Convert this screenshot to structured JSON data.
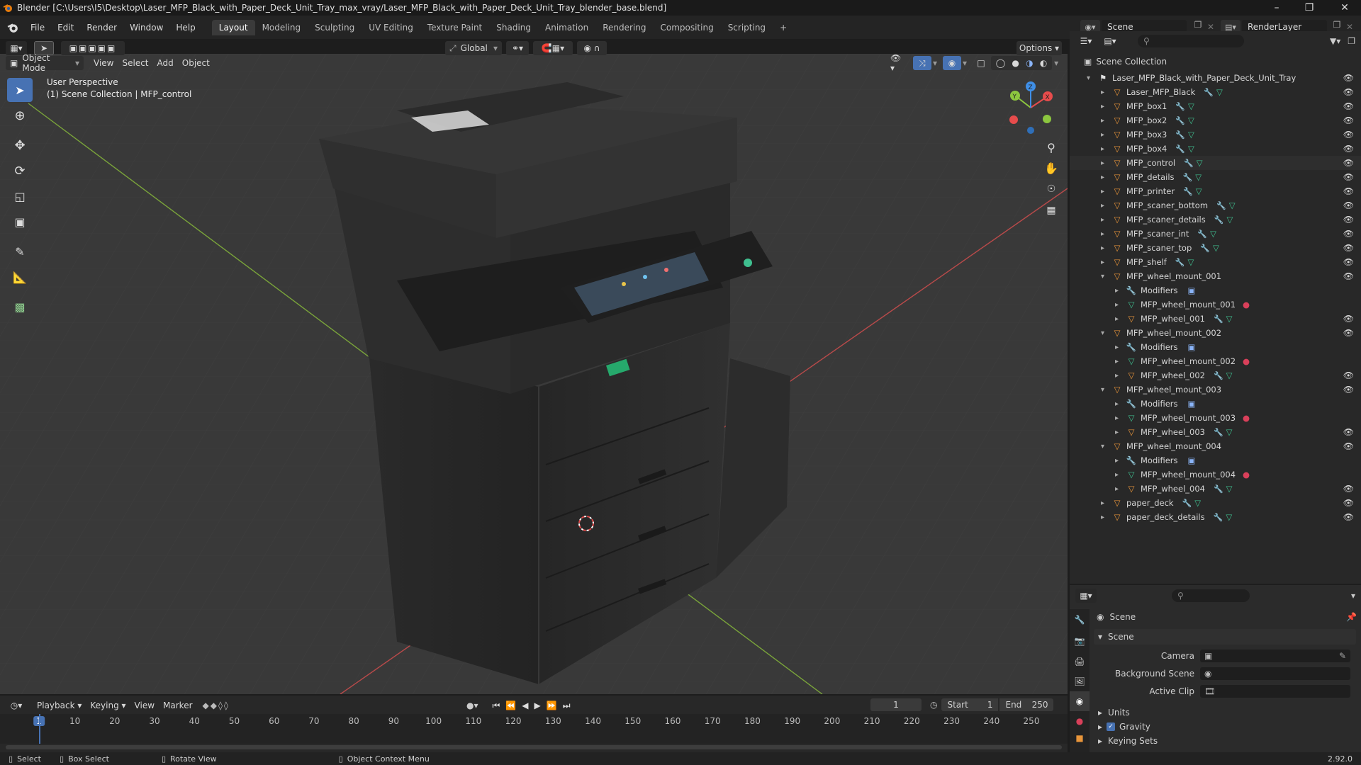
{
  "title_bar": {
    "title": "Blender [C:\\Users\\I5\\Desktop\\Laser_MFP_Black_with_Paper_Deck_Unit_Tray_max_vray/Laser_MFP_Black_with_Paper_Deck_Unit_Tray_blender_base.blend]"
  },
  "menu": [
    "File",
    "Edit",
    "Render",
    "Window",
    "Help"
  ],
  "workspaces": [
    "Layout",
    "Modeling",
    "Sculpting",
    "UV Editing",
    "Texture Paint",
    "Shading",
    "Animation",
    "Rendering",
    "Compositing",
    "Scripting"
  ],
  "workspace_active": "Layout",
  "scene_name": "Scene",
  "render_layer": "RenderLayer",
  "viewport_header": {
    "orientation": "Global",
    "options_label": "Options",
    "mode": "Object Mode",
    "menus": [
      "View",
      "Select",
      "Add",
      "Object"
    ]
  },
  "viewport": {
    "perspective": "User Perspective",
    "collection_info": "(1) Scene Collection | MFP_control",
    "gizmo_axes": [
      "X",
      "Y",
      "Z"
    ]
  },
  "outliner": {
    "root": "Scene Collection",
    "items": [
      {
        "name": "Laser_MFP_Black_with_Paper_Deck_Unit_Tray",
        "depth": 0,
        "type": "collection",
        "eye": true
      },
      {
        "name": "Laser_MFP_Black",
        "depth": 1,
        "type": "mesh",
        "eye": true
      },
      {
        "name": "MFP_box1",
        "depth": 1,
        "type": "mesh",
        "eye": true
      },
      {
        "name": "MFP_box2",
        "depth": 1,
        "type": "mesh",
        "eye": true
      },
      {
        "name": "MFP_box3",
        "depth": 1,
        "type": "mesh",
        "eye": true
      },
      {
        "name": "MFP_box4",
        "depth": 1,
        "type": "mesh",
        "eye": true
      },
      {
        "name": "MFP_control",
        "depth": 1,
        "type": "mesh",
        "eye": true
      },
      {
        "name": "MFP_details",
        "depth": 1,
        "type": "mesh",
        "eye": true
      },
      {
        "name": "MFP_printer",
        "depth": 1,
        "type": "mesh",
        "eye": true
      },
      {
        "name": "MFP_scaner_bottom",
        "depth": 1,
        "type": "mesh",
        "eye": true
      },
      {
        "name": "MFP_scaner_details",
        "depth": 1,
        "type": "mesh",
        "eye": true
      },
      {
        "name": "MFP_scaner_int",
        "depth": 1,
        "type": "mesh",
        "eye": true
      },
      {
        "name": "MFP_scaner_top",
        "depth": 1,
        "type": "mesh",
        "eye": true
      },
      {
        "name": "MFP_shelf",
        "depth": 1,
        "type": "mesh",
        "eye": true
      },
      {
        "name": "MFP_wheel_mount_001",
        "depth": 1,
        "type": "mesh-open",
        "eye": true
      },
      {
        "name": "Modifiers",
        "depth": 2,
        "type": "modifiers",
        "eye": false
      },
      {
        "name": "MFP_wheel_mount_001",
        "depth": 2,
        "type": "meshdata",
        "eye": false
      },
      {
        "name": "MFP_wheel_001",
        "depth": 2,
        "type": "mesh",
        "eye": true
      },
      {
        "name": "MFP_wheel_mount_002",
        "depth": 1,
        "type": "mesh-open",
        "eye": true
      },
      {
        "name": "Modifiers",
        "depth": 2,
        "type": "modifiers",
        "eye": false
      },
      {
        "name": "MFP_wheel_mount_002",
        "depth": 2,
        "type": "meshdata",
        "eye": false
      },
      {
        "name": "MFP_wheel_002",
        "depth": 2,
        "type": "mesh",
        "eye": true
      },
      {
        "name": "MFP_wheel_mount_003",
        "depth": 1,
        "type": "mesh-open",
        "eye": true
      },
      {
        "name": "Modifiers",
        "depth": 2,
        "type": "modifiers",
        "eye": false
      },
      {
        "name": "MFP_wheel_mount_003",
        "depth": 2,
        "type": "meshdata",
        "eye": false
      },
      {
        "name": "MFP_wheel_003",
        "depth": 2,
        "type": "mesh",
        "eye": true
      },
      {
        "name": "MFP_wheel_mount_004",
        "depth": 1,
        "type": "mesh-open",
        "eye": true
      },
      {
        "name": "Modifiers",
        "depth": 2,
        "type": "modifiers",
        "eye": false
      },
      {
        "name": "MFP_wheel_mount_004",
        "depth": 2,
        "type": "meshdata",
        "eye": false
      },
      {
        "name": "MFP_wheel_004",
        "depth": 2,
        "type": "mesh",
        "eye": true
      },
      {
        "name": "paper_deck",
        "depth": 1,
        "type": "mesh",
        "eye": true
      },
      {
        "name": "paper_deck_details",
        "depth": 1,
        "type": "mesh",
        "eye": true
      }
    ]
  },
  "properties": {
    "breadcrumb": "Scene",
    "section": "Scene",
    "fields": [
      {
        "label": "Camera",
        "value": ""
      },
      {
        "label": "Background Scene",
        "value": ""
      },
      {
        "label": "Active Clip",
        "value": ""
      }
    ],
    "subsections": [
      "Units",
      "Gravity",
      "Keying Sets"
    ],
    "gravity_checked": true
  },
  "timeline": {
    "menus": [
      "Playback",
      "Keying",
      "View",
      "Marker"
    ],
    "current_frame": "1",
    "start_label": "Start",
    "start": "1",
    "end_label": "End",
    "end": "250",
    "ticks": [
      "1",
      "10",
      "20",
      "30",
      "40",
      "50",
      "60",
      "70",
      "80",
      "90",
      "100",
      "110",
      "120",
      "130",
      "140",
      "150",
      "160",
      "170",
      "180",
      "190",
      "200",
      "210",
      "220",
      "230",
      "240",
      "250"
    ]
  },
  "statusbar": {
    "items": [
      "Select",
      "Box Select",
      "Rotate View",
      "Object Context Menu"
    ],
    "version": "2.92.0"
  },
  "colors": {
    "accent": "#4772b3",
    "mesh_icon": "#e8953a",
    "meshdata_icon": "#3fbf8f",
    "modifier_icon": "#8ab4f8",
    "material_icon": "#d9405a",
    "axis_x": "#e74c4c",
    "axis_y": "#8cc63f",
    "axis_z": "#3f8fe7"
  }
}
